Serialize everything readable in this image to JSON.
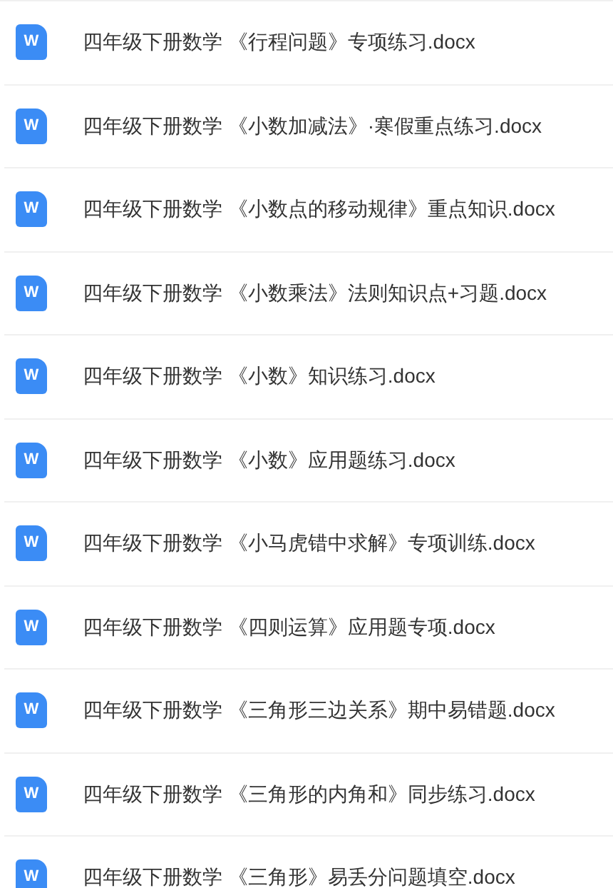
{
  "files": [
    {
      "icon_label": "W",
      "name": "四年级下册数学 《行程问题》专项练习.docx"
    },
    {
      "icon_label": "W",
      "name": "四年级下册数学 《小数加减法》·寒假重点练习.docx"
    },
    {
      "icon_label": "W",
      "name": "四年级下册数学 《小数点的移动规律》重点知识.docx"
    },
    {
      "icon_label": "W",
      "name": "四年级下册数学 《小数乘法》法则知识点+习题.docx"
    },
    {
      "icon_label": "W",
      "name": "四年级下册数学 《小数》知识练习.docx"
    },
    {
      "icon_label": "W",
      "name": "四年级下册数学 《小数》应用题练习.docx"
    },
    {
      "icon_label": "W",
      "name": "四年级下册数学 《小马虎错中求解》专项训练.docx"
    },
    {
      "icon_label": "W",
      "name": "四年级下册数学 《四则运算》应用题专项.docx"
    },
    {
      "icon_label": "W",
      "name": "四年级下册数学 《三角形三边关系》期中易错题.docx"
    },
    {
      "icon_label": "W",
      "name": "四年级下册数学 《三角形的内角和》同步练习.docx"
    },
    {
      "icon_label": "W",
      "name": "四年级下册数学 《三角形》易丢分问题填空.docx"
    }
  ]
}
